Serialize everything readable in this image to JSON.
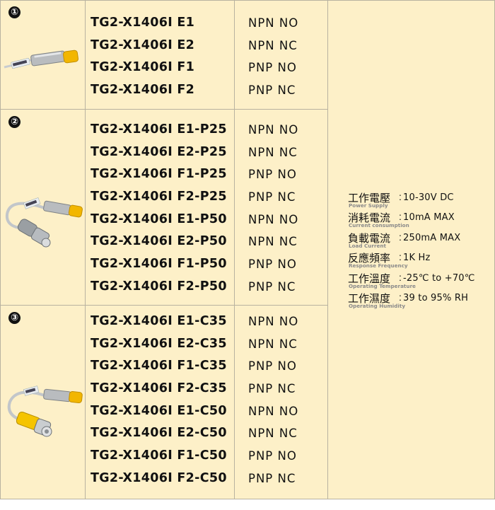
{
  "groups": [
    {
      "number": "①",
      "image": "sensor-with-fixed-cable",
      "rows": [
        {
          "model": "TG2-X1406I E1",
          "output": "NPN NO"
        },
        {
          "model": "TG2-X1406I E2",
          "output": "NPN NC"
        },
        {
          "model": "TG2-X1406I F1",
          "output": "PNP NO"
        },
        {
          "model": "TG2-X1406I F2",
          "output": "PNP NC"
        }
      ]
    },
    {
      "number": "②",
      "image": "sensor-with-cable-and-gray-connector",
      "rows": [
        {
          "model": "TG2-X1406I E1-P25",
          "output": "NPN NO"
        },
        {
          "model": "TG2-X1406I E2-P25",
          "output": "NPN NC"
        },
        {
          "model": "TG2-X1406I F1-P25",
          "output": "PNP NO"
        },
        {
          "model": "TG2-X1406I F2-P25",
          "output": "PNP NC"
        },
        {
          "model": "TG2-X1406I E1-P50",
          "output": "NPN NO"
        },
        {
          "model": "TG2-X1406I E2-P50",
          "output": "NPN NC"
        },
        {
          "model": "TG2-X1406I F1-P50",
          "output": "PNP NO"
        },
        {
          "model": "TG2-X1406I F2-P50",
          "output": "PNP NC"
        }
      ]
    },
    {
      "number": "③",
      "image": "sensor-with-cable-and-yellow-connector",
      "rows": [
        {
          "model": "TG2-X1406I E1-C35",
          "output": "NPN NO"
        },
        {
          "model": "TG2-X1406I E2-C35",
          "output": "NPN NC"
        },
        {
          "model": "TG2-X1406I F1-C35",
          "output": "PNP NO"
        },
        {
          "model": "TG2-X1406I F2-C35",
          "output": "PNP NC"
        },
        {
          "model": "TG2-X1406I E1-C50",
          "output": "NPN NO"
        },
        {
          "model": "TG2-X1406I E2-C50",
          "output": "NPN NC"
        },
        {
          "model": "TG2-X1406I F1-C50",
          "output": "PNP NO"
        },
        {
          "model": "TG2-X1406I F2-C50",
          "output": "PNP NC"
        }
      ]
    }
  ],
  "specs": [
    {
      "label": "工作電壓",
      "label_en": "Power Supply",
      "value": "10-30V DC"
    },
    {
      "label": "消耗電流",
      "label_en": "Current consumption",
      "value": "10mA MAX"
    },
    {
      "label": "負載電流",
      "label_en": "Load Current",
      "value": "250mA MAX"
    },
    {
      "label": "反應頻率",
      "label_en": "Response Frequency",
      "value": "1K Hz"
    },
    {
      "label": "工作溫度",
      "label_en": "Operating Temperature",
      "value": "-25℃ to +70℃"
    },
    {
      "label": "工作濕度",
      "label_en": "Operating Humidity",
      "value": "39 to 95% RH"
    }
  ],
  "colors": {
    "background": "#fdf0c8",
    "grid_line": "#b8b2a0",
    "sensor_cap": "#f2b600",
    "connector_yellow": "#f5c400",
    "connector_gray": "#9a9fa3"
  }
}
